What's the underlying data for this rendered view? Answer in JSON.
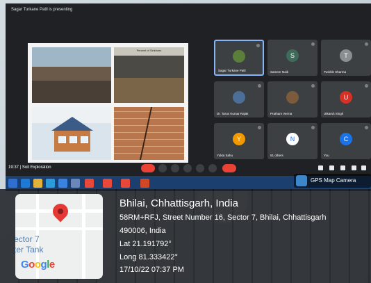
{
  "meet": {
    "presenting_text": "Sagar Turkane Patil is presenting",
    "meeting_time_title": "19:37 | Soil Exploration",
    "slide_photo_title": "Percent of Sinkhoes",
    "participants": [
      {
        "name": "Sagar Turkane Patil",
        "initial": "",
        "color": "#5b7f3a",
        "active": true
      },
      {
        "name": "Sameer Naik",
        "initial": "S",
        "color": "#3f6c5a",
        "active": false
      },
      {
        "name": "Twinkle Sharma",
        "initial": "T",
        "color": "#8a8f93",
        "active": false
      },
      {
        "name": "Dr. Tarun Kumar Rajak",
        "initial": "",
        "color": "#4b6f96",
        "active": false
      },
      {
        "name": "Pratham Verma",
        "initial": "",
        "color": "#7b5b3b",
        "active": false
      },
      {
        "name": "Utkarsh Singh",
        "initial": "U",
        "color": "#d93025",
        "active": false
      },
      {
        "name": "Yukta Sahu",
        "initial": "Y",
        "color": "#f29900",
        "active": false
      },
      {
        "name": "51 others",
        "initial": "N",
        "color": "#ffffff",
        "active": false
      },
      {
        "name": "You",
        "initial": "C",
        "color": "#1a73e8",
        "active": false
      }
    ]
  },
  "gps_app": {
    "label": "GPS Map Camera"
  },
  "location": {
    "title": "Bhilai, Chhattisgarh, India",
    "address_line1": "58RM+RFJ, Street Number 16, Sector 7, Bhilai, Chhattisgarh",
    "address_line2": "490006, India",
    "lat": "Lat 21.191792°",
    "long": "Long 81.333422°",
    "datetime": "17/10/22 07:37 PM"
  },
  "map": {
    "sector_label": "ector 7",
    "tank_label": "ter Tank",
    "google_letters": [
      "G",
      "o",
      "o",
      "g",
      "l",
      "e"
    ]
  }
}
